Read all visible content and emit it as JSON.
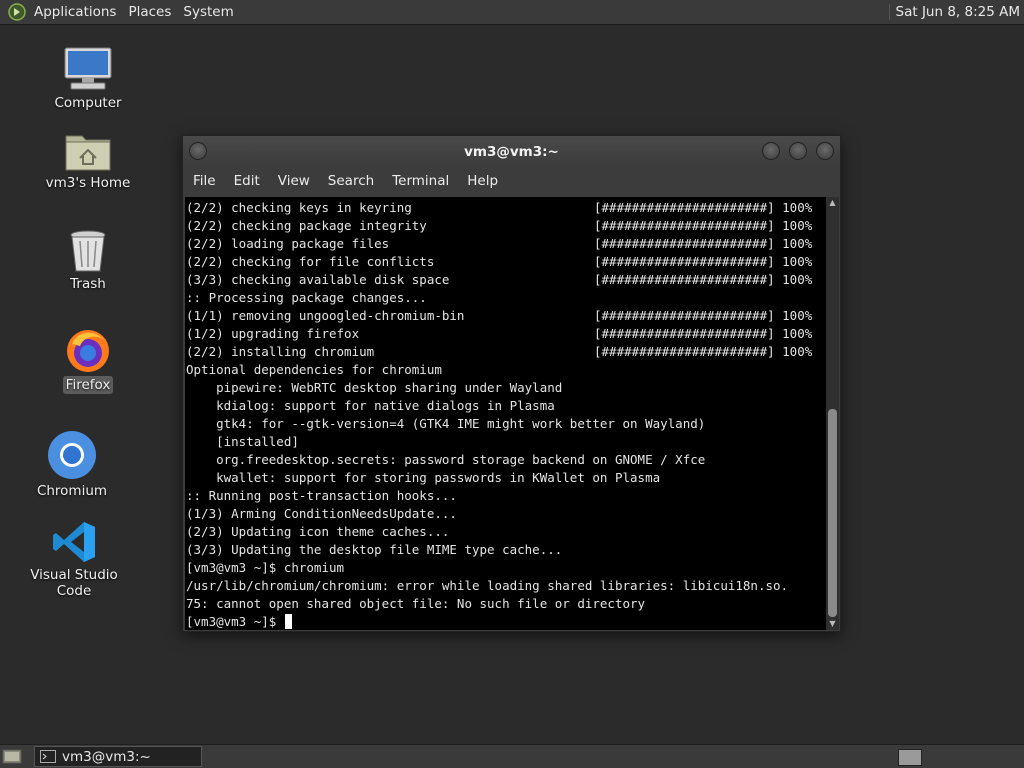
{
  "top_panel": {
    "menus": [
      "Applications",
      "Places",
      "System"
    ],
    "clock": "Sat Jun  8,  8:25 AM"
  },
  "desktop_icons": [
    {
      "label": "Computer",
      "icon": "computer-icon"
    },
    {
      "label": "vm3's Home",
      "icon": "home-folder-icon"
    },
    {
      "label": "Trash",
      "icon": "trash-icon"
    },
    {
      "label": "Firefox",
      "icon": "firefox-icon",
      "selected": true
    },
    {
      "label": "Chromium",
      "icon": "chromium-icon"
    },
    {
      "label": "Visual Studio Code",
      "icon": "vscode-icon"
    }
  ],
  "terminal": {
    "title": "vm3@vm3:~",
    "menu": [
      "File",
      "Edit",
      "View",
      "Search",
      "Terminal",
      "Help"
    ],
    "lines": [
      {
        "text": "(2/2) checking keys in keyring",
        "progress": "[######################] 100%"
      },
      {
        "text": "(2/2) checking package integrity",
        "progress": "[######################] 100%"
      },
      {
        "text": "(2/2) loading package files",
        "progress": "[######################] 100%"
      },
      {
        "text": "(2/2) checking for file conflicts",
        "progress": "[######################] 100%"
      },
      {
        "text": "(3/3) checking available disk space",
        "progress": "[######################] 100%"
      },
      {
        "text": ":: Processing package changes..."
      },
      {
        "text": "(1/1) removing ungoogled-chromium-bin",
        "progress": "[######################] 100%"
      },
      {
        "text": "(1/2) upgrading firefox",
        "progress": "[######################] 100%"
      },
      {
        "text": "(2/2) installing chromium",
        "progress": "[######################] 100%"
      },
      {
        "text": "Optional dependencies for chromium"
      },
      {
        "text": "    pipewire: WebRTC desktop sharing under Wayland"
      },
      {
        "text": "    kdialog: support for native dialogs in Plasma"
      },
      {
        "text": "    gtk4: for --gtk-version=4 (GTK4 IME might work better on Wayland)"
      },
      {
        "text": "    [installed]"
      },
      {
        "text": "    org.freedesktop.secrets: password storage backend on GNOME / Xfce"
      },
      {
        "text": "    kwallet: support for storing passwords in KWallet on Plasma"
      },
      {
        "text": ":: Running post-transaction hooks..."
      },
      {
        "text": "(1/3) Arming ConditionNeedsUpdate..."
      },
      {
        "text": "(2/3) Updating icon theme caches..."
      },
      {
        "text": "(3/3) Updating the desktop file MIME type cache..."
      },
      {
        "text": "[vm3@vm3 ~]$ chromium"
      },
      {
        "text": "/usr/lib/chromium/chromium: error while loading shared libraries: libicui18n.so."
      },
      {
        "text": "75: cannot open shared object file: No such file or directory"
      }
    ],
    "prompt": "[vm3@vm3 ~]$ "
  },
  "taskbar": {
    "task_label": "vm3@vm3:~"
  }
}
